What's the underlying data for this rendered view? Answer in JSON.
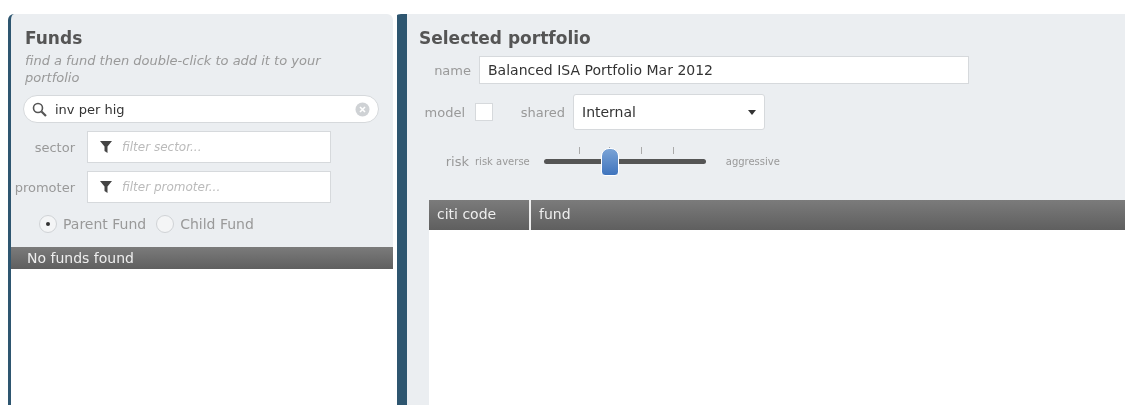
{
  "funds": {
    "title": "Funds",
    "hint": "find a fund then double-click to add it to your portfolio",
    "search": {
      "value": "inv per hig"
    },
    "filters": [
      {
        "label": "sector",
        "placeholder": "filter sector..."
      },
      {
        "label": "promoter",
        "placeholder": "filter promoter..."
      }
    ],
    "fund_type": [
      {
        "label": "Parent Fund",
        "selected": true
      },
      {
        "label": "Child Fund",
        "selected": false
      }
    ],
    "results_header": "No funds found"
  },
  "portfolio": {
    "title": "Selected portfolio",
    "name": {
      "label": "name",
      "value": "Balanced ISA Portfolio Mar 2012"
    },
    "model": {
      "label": "model",
      "checked": false
    },
    "shared": {
      "label": "shared",
      "value": "Internal"
    },
    "risk": {
      "label": "risk",
      "min_label": "risk averse",
      "max_label": "aggressive",
      "level": 0.4
    },
    "table": {
      "columns": [
        "citi code",
        "fund"
      ]
    }
  }
}
